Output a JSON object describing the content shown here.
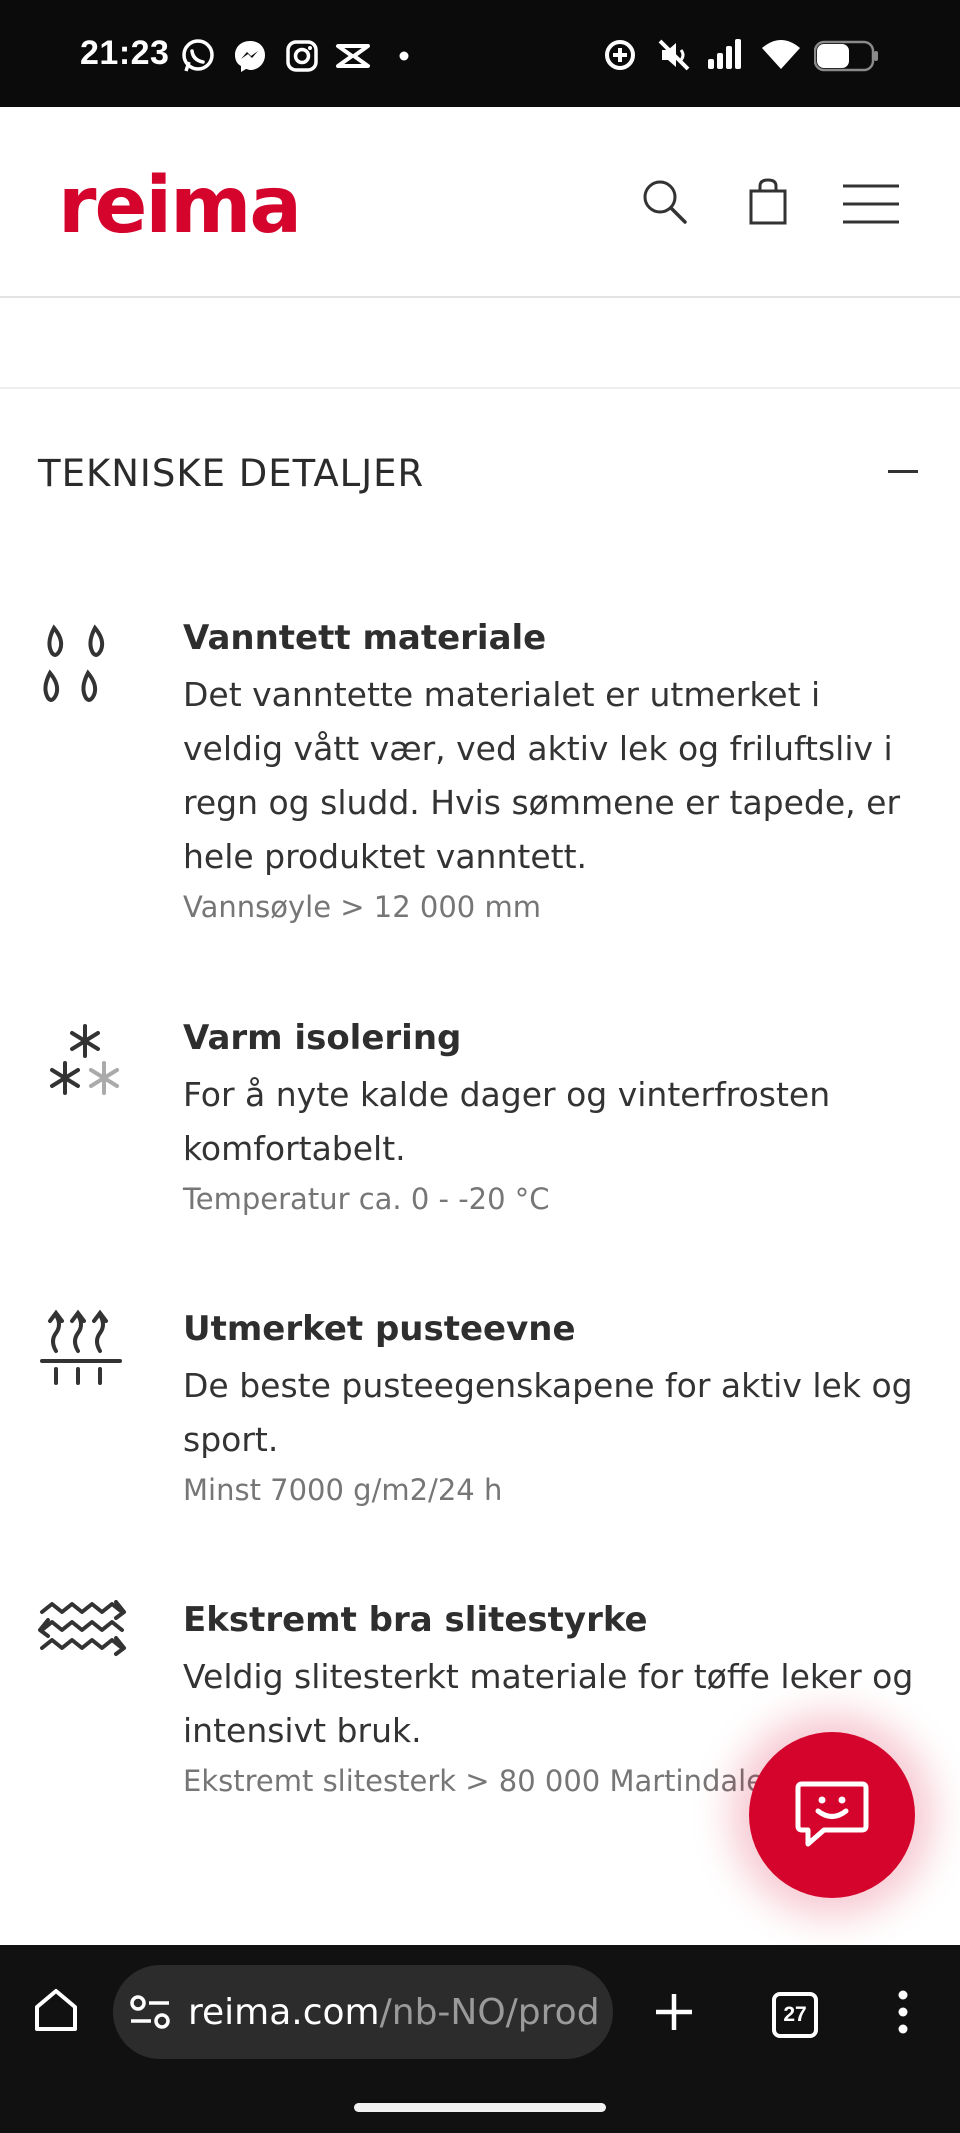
{
  "status_bar": {
    "time": "21:23",
    "left_icons": [
      "whatsapp-icon",
      "messenger-icon",
      "instagram-icon",
      "capcut-icon",
      "dot-icon"
    ],
    "right_icons": [
      "data-saver-icon",
      "mute-icon",
      "signal-icon",
      "wifi-icon",
      "battery-icon"
    ]
  },
  "header": {
    "logo": "reima",
    "brand_color": "#d4042d",
    "icons": [
      "search-icon",
      "shopping-bag-icon",
      "menu-icon"
    ]
  },
  "section": {
    "title": "TEKNISKE DETALJER",
    "toggle_icon": "minus-icon"
  },
  "features": [
    {
      "icon": "water-drops-icon",
      "title": "Vanntett materiale",
      "description": "Det vanntette materialet er utmerket i veldig vått vær, ved aktiv lek og friluftsliv i regn og sludd. Hvis sømmene er tapede, er hele produktet vanntett.",
      "spec": "Vannsøyle > 12 000 mm"
    },
    {
      "icon": "snowflakes-icon",
      "title": "Varm isolering",
      "description": "For å nyte kalde dager og vinterfrosten komfortabelt.",
      "spec": "Temperatur ca. 0 - -20 °C"
    },
    {
      "icon": "breathability-icon",
      "title": "Utmerket pusteevne",
      "description": "De beste pusteegenskapene for aktiv lek og sport.",
      "spec": "Minst 7000 g/m2/24 h"
    },
    {
      "icon": "durability-icon",
      "title": "Ekstremt bra slitestyrke",
      "description": "Veldig slitesterkt materiale for tøffe leker og intensivt bruk.",
      "spec": "Ekstremt slitesterk > 80 000 Martindale"
    }
  ],
  "chat_button": {
    "icon": "chat-smiley-icon"
  },
  "browser": {
    "url_domain": "reima.com",
    "url_path": "/nb-NO/produ",
    "tab_count": "27",
    "icons": [
      "home-icon",
      "site-settings-icon",
      "new-tab-icon",
      "tabs-icon",
      "more-icon"
    ]
  }
}
